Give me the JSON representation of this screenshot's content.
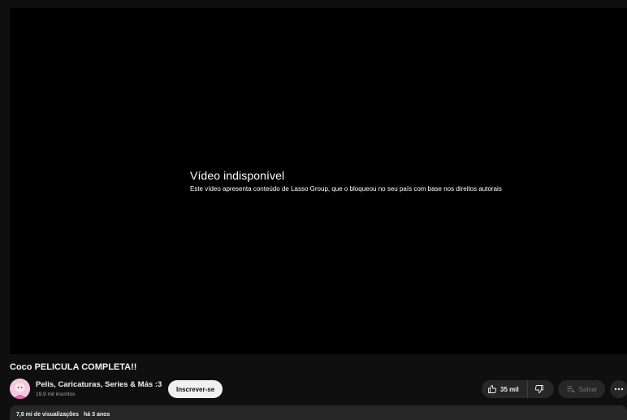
{
  "player": {
    "error_title": "Vídeo indisponível",
    "error_message": "Este vídeo apresenta conteúdo de Lasso Group, que o bloqueou no seu país com base nos direitos autorais"
  },
  "video": {
    "title": "Coco PELICULA COMPLETA!!"
  },
  "channel": {
    "name": "Pelis, Caricaturas, Series & Más :3",
    "subscribers": "19,9 mil inscritos",
    "subscribe_label": "Inscrever-se"
  },
  "actions": {
    "like_count": "35 mil",
    "save_label": "Salvar"
  },
  "description": {
    "views": "7,6 mi de visualizações",
    "age": "há 3 anos"
  },
  "colors": {
    "background": "#0f0f0f",
    "player": "#000000",
    "button_bg": "#272727",
    "subscribe_bg": "#f1f1f1"
  },
  "icons": [
    "like-icon",
    "dislike-icon",
    "save-icon",
    "more-icon",
    "channel-avatar"
  ]
}
